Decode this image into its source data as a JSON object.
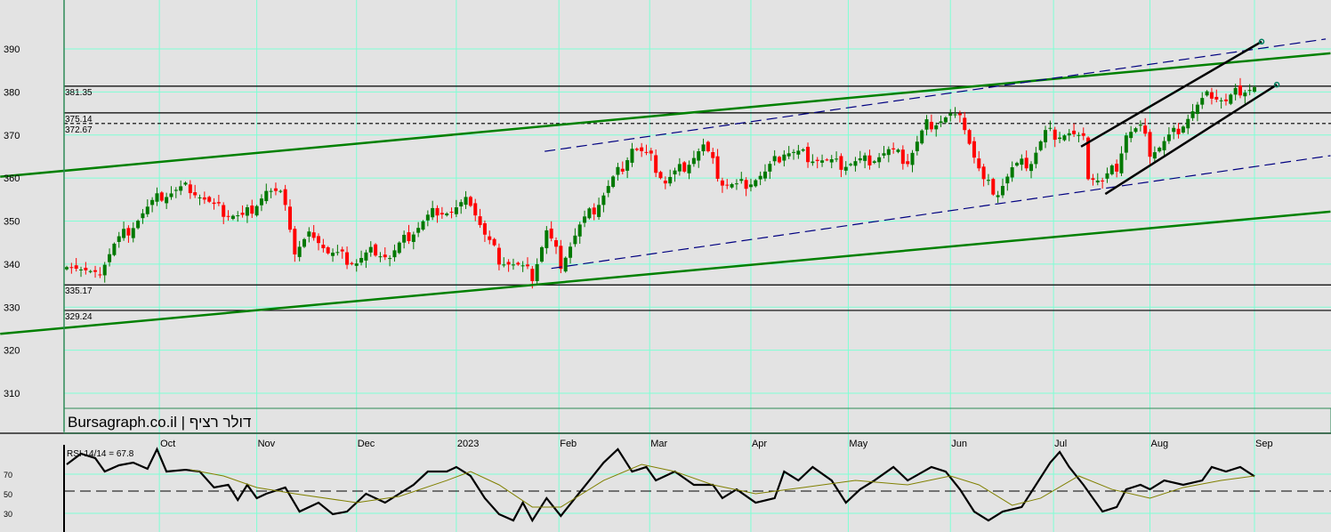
{
  "title": "Bursagraph.co.il | דולר רציף",
  "rsi_label": "RSI 14/14 = 67.8",
  "colors": {
    "up": "#007800",
    "down": "#ff0000",
    "grid": "#7fffd4",
    "trend_green": "#008000",
    "trend_blue": "#000080",
    "rsi_ma": "#808000",
    "rsi_mid": "#ff0000",
    "bg": "#e3e3e3"
  },
  "chart_data": [
    {
      "type": "candlestick",
      "title": "Bursagraph.co.il | דולר רציף",
      "xlabel": "",
      "ylabel": "",
      "ylim": [
        301.1,
        401.4
      ],
      "xlim": [
        -14,
        266
      ],
      "grid": true,
      "y_ticks": [
        310,
        320,
        330,
        340,
        350,
        360,
        370,
        380,
        390
      ],
      "x_ticks": [
        {
          "label": "Oct",
          "day": 19.5
        },
        {
          "label": "Nov",
          "day": 40
        },
        {
          "label": "Dec",
          "day": 61
        },
        {
          "label": "2023",
          "day": 82
        },
        {
          "label": "Feb",
          "day": 103.6
        },
        {
          "label": "Mar",
          "day": 122.7
        },
        {
          "label": "Apr",
          "day": 144
        },
        {
          "label": "May",
          "day": 164.5
        },
        {
          "label": "Jun",
          "day": 186
        },
        {
          "label": "Jul",
          "day": 207.7
        },
        {
          "label": "Aug",
          "day": 228
        },
        {
          "label": "Sep",
          "day": 250
        }
      ],
      "close_keypoints": [
        [
          0,
          340.8
        ],
        [
          6,
          336.7
        ],
        [
          10,
          344.5
        ],
        [
          16,
          351.8
        ],
        [
          20,
          356
        ],
        [
          26,
          358
        ],
        [
          31,
          353
        ],
        [
          37,
          350.7
        ],
        [
          42,
          357
        ],
        [
          46,
          355
        ],
        [
          48,
          342.5
        ],
        [
          52,
          347.6
        ],
        [
          55,
          342.5
        ],
        [
          61,
          340.4
        ],
        [
          65,
          343.5
        ],
        [
          68,
          341.4
        ],
        [
          72,
          346.6
        ],
        [
          78,
          352.8
        ],
        [
          81,
          352
        ],
        [
          85,
          354.8
        ],
        [
          88,
          346.6
        ],
        [
          91,
          341.4
        ],
        [
          95,
          339.4
        ],
        [
          98,
          337.3
        ],
        [
          101,
          347.6
        ],
        [
          104,
          340.4
        ],
        [
          108,
          348.7
        ],
        [
          111,
          352.8
        ],
        [
          117,
          363
        ],
        [
          119,
          367.3
        ],
        [
          123,
          364.2
        ],
        [
          126,
          359
        ],
        [
          130,
          363
        ],
        [
          134,
          367.3
        ],
        [
          138,
          359
        ],
        [
          141,
          358
        ],
        [
          147,
          361
        ],
        [
          151,
          366.2
        ],
        [
          156,
          365.2
        ],
        [
          162,
          363
        ],
        [
          168,
          364
        ],
        [
          173,
          366.2
        ],
        [
          177,
          364
        ],
        [
          181,
          372.4
        ],
        [
          186,
          374.5
        ],
        [
          189,
          372.4
        ],
        [
          191,
          365
        ],
        [
          193,
          359
        ],
        [
          196,
          357
        ],
        [
          199,
          362
        ],
        [
          203,
          364
        ],
        [
          206,
          370.4
        ],
        [
          211,
          370.4
        ],
        [
          214,
          368.3
        ],
        [
          215,
          361
        ],
        [
          218,
          359
        ],
        [
          221,
          363
        ],
        [
          223,
          370.4
        ],
        [
          226,
          371.4
        ],
        [
          228,
          366.2
        ],
        [
          230,
          367.3
        ],
        [
          233,
          370.4
        ],
        [
          237,
          375.5
        ],
        [
          241,
          379.7
        ],
        [
          244,
          377.6
        ],
        [
          247,
          380.7
        ],
        [
          250,
          381.1
        ]
      ],
      "levels": [
        {
          "value": 381.35,
          "label": "381.35",
          "style": "solid"
        },
        {
          "value": 375.14,
          "label": "375.14",
          "style": "solid"
        },
        {
          "value": 372.67,
          "label": "372.67",
          "style": "dashed"
        },
        {
          "value": 335.17,
          "label": "335.17",
          "style": "solid"
        },
        {
          "value": 329.24,
          "label": "329.24",
          "style": "solid"
        }
      ],
      "trendlines": [
        {
          "name": "green-upper",
          "color": "green",
          "from": [
            -14,
            360.3
          ],
          "to": [
            266,
            389
          ]
        },
        {
          "name": "green-lower",
          "color": "green",
          "from": [
            -14,
            323.8
          ],
          "to": [
            266,
            352.2
          ]
        },
        {
          "name": "blue-upper",
          "color": "blue",
          "from": [
            100.6,
            366.2
          ],
          "to": [
            265,
            392.3
          ]
        },
        {
          "name": "blue-lower",
          "color": "blue",
          "from": [
            102,
            339
          ],
          "to": [
            266,
            365.2
          ]
        },
        {
          "name": "channel-upper",
          "color": "black",
          "from": [
            213.5,
            367.3
          ],
          "to": [
            251.5,
            391.7
          ]
        },
        {
          "name": "channel-lower",
          "color": "black",
          "from": [
            218.6,
            356.3
          ],
          "to": [
            254.7,
            381.7
          ]
        }
      ]
    },
    {
      "type": "line",
      "title": "RSI 14/14 = 67.8",
      "y_ticks": [
        30,
        50,
        70
      ],
      "ylim": [
        10,
        120
      ],
      "series": [
        {
          "name": "RSI",
          "points": [
            [
              0,
              80
            ],
            [
              3,
              90.9
            ],
            [
              6,
              86.4
            ],
            [
              8,
              72.7
            ],
            [
              11,
              79.1
            ],
            [
              14,
              81.8
            ],
            [
              17,
              75.5
            ],
            [
              19,
              95.5
            ],
            [
              21,
              72.7
            ],
            [
              25,
              74.5
            ],
            [
              28,
              72.7
            ],
            [
              31,
              56.4
            ],
            [
              34,
              59.1
            ],
            [
              36,
              43.6
            ],
            [
              38,
              59.1
            ],
            [
              40,
              45.5
            ],
            [
              42,
              50
            ],
            [
              46,
              56.4
            ],
            [
              49,
              31.8
            ],
            [
              53,
              40.9
            ],
            [
              56,
              29.1
            ],
            [
              59,
              31.8
            ],
            [
              63,
              50
            ],
            [
              67,
              40.9
            ],
            [
              70,
              50
            ],
            [
              73,
              59.1
            ],
            [
              76,
              72.7
            ],
            [
              80,
              72.7
            ],
            [
              82,
              77.3
            ],
            [
              85,
              68.2
            ],
            [
              88,
              45.5
            ],
            [
              91,
              29.1
            ],
            [
              94,
              22.7
            ],
            [
              96,
              40.9
            ],
            [
              98,
              22.7
            ],
            [
              101,
              45.5
            ],
            [
              104,
              27.3
            ],
            [
              107,
              45.5
            ],
            [
              110,
              63.6
            ],
            [
              113,
              81.8
            ],
            [
              116,
              95.5
            ],
            [
              119,
              72.7
            ],
            [
              122,
              77.3
            ],
            [
              124,
              63.6
            ],
            [
              128,
              72.7
            ],
            [
              132,
              59.1
            ],
            [
              136,
              59.1
            ],
            [
              138,
              45.5
            ],
            [
              141,
              54.5
            ],
            [
              145,
              40.9
            ],
            [
              149,
              45.5
            ],
            [
              151,
              72.7
            ],
            [
              154,
              63.6
            ],
            [
              157,
              77.3
            ],
            [
              161,
              63.6
            ],
            [
              164,
              40.9
            ],
            [
              167,
              54.5
            ],
            [
              170,
              63.6
            ],
            [
              174,
              77.3
            ],
            [
              177,
              63.6
            ],
            [
              182,
              77.3
            ],
            [
              185,
              72.7
            ],
            [
              188,
              54.5
            ],
            [
              191,
              31.8
            ],
            [
              194,
              22.7
            ],
            [
              197,
              31.8
            ],
            [
              201,
              36.4
            ],
            [
              204,
              59.1
            ],
            [
              207,
              81.8
            ],
            [
              209,
              92.7
            ],
            [
              211,
              77.3
            ],
            [
              214,
              59.1
            ],
            [
              218,
              31.8
            ],
            [
              221,
              36.4
            ],
            [
              223,
              54.5
            ],
            [
              226,
              59.1
            ],
            [
              228,
              54.5
            ],
            [
              231,
              63.6
            ],
            [
              235,
              59.1
            ],
            [
              239,
              63.6
            ],
            [
              241,
              77.3
            ],
            [
              244,
              72.7
            ],
            [
              247,
              77.3
            ],
            [
              250,
              67.8
            ]
          ]
        },
        {
          "name": "RSI average",
          "points": [
            [
              26,
              74.5
            ],
            [
              33,
              68.2
            ],
            [
              40,
              56.4
            ],
            [
              48,
              50
            ],
            [
              61,
              40.9
            ],
            [
              70,
              47.3
            ],
            [
              80,
              63.6
            ],
            [
              85,
              72.7
            ],
            [
              91,
              59.1
            ],
            [
              98,
              36.4
            ],
            [
              104,
              36.4
            ],
            [
              113,
              63.6
            ],
            [
              121,
              80
            ],
            [
              128,
              72.7
            ],
            [
              136,
              59.1
            ],
            [
              145,
              50
            ],
            [
              155,
              56.4
            ],
            [
              166,
              63.6
            ],
            [
              177,
              59.1
            ],
            [
              186,
              68.2
            ],
            [
              192,
              59.1
            ],
            [
              199,
              38.2
            ],
            [
              205,
              45.5
            ],
            [
              213,
              68.2
            ],
            [
              220,
              54.5
            ],
            [
              228,
              45.5
            ],
            [
              235,
              56.4
            ],
            [
              243,
              63.6
            ],
            [
              250,
              68.2
            ]
          ]
        }
      ],
      "reference_line": 50
    }
  ]
}
